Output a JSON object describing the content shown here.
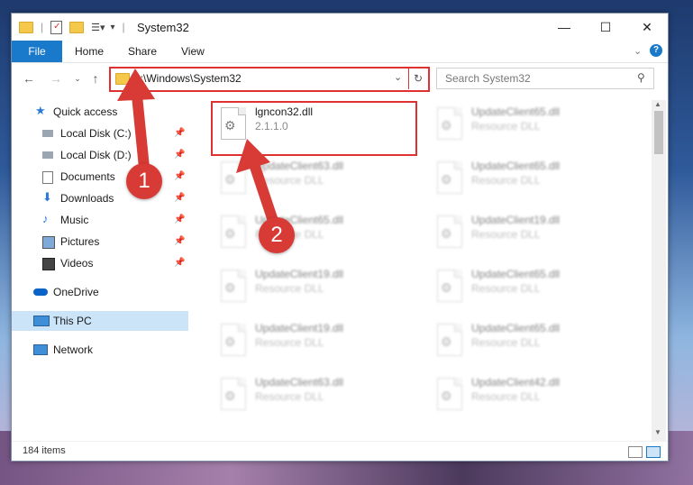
{
  "window": {
    "title": "System32"
  },
  "ribbon": {
    "tabs": [
      "File",
      "Home",
      "Share",
      "View"
    ]
  },
  "address": {
    "path": "C:\\Windows\\System32"
  },
  "search": {
    "placeholder": "Search System32"
  },
  "sidebar": {
    "quick_access": "Quick access",
    "items": [
      {
        "label": "Local Disk (C:)",
        "icon": "drive-icon"
      },
      {
        "label": "Local Disk (D:)",
        "icon": "drive-icon"
      },
      {
        "label": "Documents",
        "icon": "documents-icon"
      },
      {
        "label": "Downloads",
        "icon": "downloads-icon"
      },
      {
        "label": "Music",
        "icon": "music-icon"
      },
      {
        "label": "Pictures",
        "icon": "pictures-icon"
      },
      {
        "label": "Videos",
        "icon": "videos-icon"
      }
    ],
    "onedrive": "OneDrive",
    "this_pc": "This PC",
    "network": "Network"
  },
  "files": [
    {
      "name": "lgncon32.dll",
      "desc": "2.1.1.0",
      "highlight": true
    },
    {
      "name": "UpdateClient65.dll",
      "desc": "Resource DLL"
    },
    {
      "name": "UpdateClient63.dll",
      "desc": "Resource DLL"
    },
    {
      "name": "UpdateClient65.dll",
      "desc": "Resource DLL"
    },
    {
      "name": "UpdateClient65.dll",
      "desc": "Resource DLL"
    },
    {
      "name": "UpdateClient19.dll",
      "desc": "Resource DLL"
    },
    {
      "name": "UpdateClient19.dll",
      "desc": "Resource DLL"
    },
    {
      "name": "UpdateClient65.dll",
      "desc": "Resource DLL"
    },
    {
      "name": "UpdateClient19.dll",
      "desc": "Resource DLL"
    },
    {
      "name": "UpdateClient65.dll",
      "desc": "Resource DLL"
    },
    {
      "name": "UpdateClient63.dll",
      "desc": "Resource DLL"
    },
    {
      "name": "UpdateClient42.dll",
      "desc": "Resource DLL"
    }
  ],
  "status": {
    "count": "184 items"
  },
  "annotations": {
    "step1": "1",
    "step2": "2"
  },
  "colors": {
    "accent": "#1979ca",
    "highlight": "#e03030",
    "selected": "#cce4f7"
  }
}
